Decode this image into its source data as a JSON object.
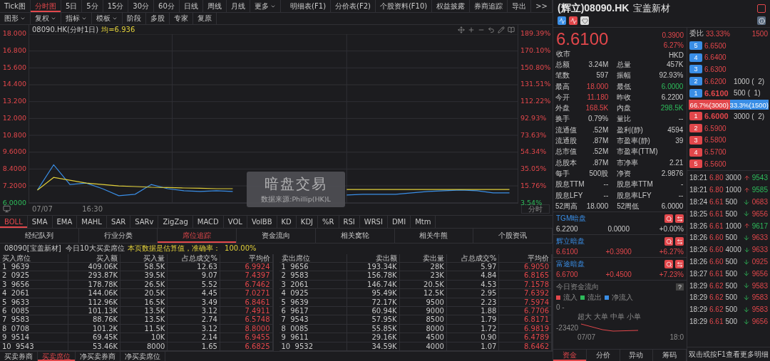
{
  "toolbar": {
    "tabs": [
      {
        "label": "Tick图",
        "selected": false,
        "dropdown": false
      },
      {
        "label": "分时图",
        "selected": true,
        "dropdown": false
      },
      {
        "label": "5日",
        "selected": false,
        "dropdown": false
      },
      {
        "label": "5分",
        "selected": false,
        "dropdown": false
      },
      {
        "label": "15分",
        "selected": false,
        "dropdown": false
      },
      {
        "label": "30分",
        "selected": false,
        "dropdown": false
      },
      {
        "label": "60分",
        "selected": false,
        "dropdown": false
      },
      {
        "label": "日线",
        "selected": false,
        "dropdown": false
      },
      {
        "label": "周线",
        "selected": false,
        "dropdown": false
      },
      {
        "label": "月线",
        "selected": false,
        "dropdown": false
      },
      {
        "label": "更多",
        "selected": false,
        "dropdown": true
      }
    ],
    "actions": [
      "明细表(F1)",
      "分价表(F2)",
      "个股资料(F10)",
      "权益披露",
      "券商追踪",
      "导出",
      ">>"
    ]
  },
  "subtoolbar": [
    {
      "label": "图形",
      "dropdown": true
    },
    {
      "label": "复权",
      "dropdown": true
    },
    {
      "label": "指标",
      "dropdown": true
    },
    {
      "label": "模板",
      "dropdown": true
    },
    {
      "label": "阶段",
      "dropdown": false
    },
    {
      "label": "多股",
      "dropdown": false
    },
    {
      "label": "专家",
      "dropdown": false
    },
    {
      "label": "复原",
      "dropdown": false
    }
  ],
  "chart": {
    "title": "08090.HK(分时1日)",
    "average": "均=6.936",
    "pct_ticks": [
      "189.39%",
      "170.10%",
      "150.80%",
      "131.51%",
      "112.22%",
      "92.93%",
      "73.63%",
      "54.34%",
      "35.05%",
      "15.76%",
      "3.54%"
    ],
    "x_labels": [
      "07/07",
      "16:30"
    ],
    "mode_button": "分时",
    "overlay_title": "暗盘交易",
    "overlay_source": "数据来源:Phillip(HK)L",
    "chart_data": {
      "type": "line",
      "grid": true,
      "ylim": [
        6,
        18
      ],
      "yticks": [
        {
          "value": 18,
          "label": "18.000"
        },
        {
          "value": 16.8,
          "label": "16.800"
        },
        {
          "value": 15.6,
          "label": "15.600"
        },
        {
          "value": 14.4,
          "label": "14.400"
        },
        {
          "value": 13.2,
          "label": "13.200"
        },
        {
          "value": 12,
          "label": "12.000"
        },
        {
          "value": 10.8,
          "label": "10.800"
        },
        {
          "value": 9.6,
          "label": "9.6000"
        },
        {
          "value": 8.4,
          "label": "8.4000"
        },
        {
          "value": 7.2,
          "label": "7.2000"
        },
        {
          "value": 6,
          "label": "6.0000"
        }
      ],
      "series": [
        {
          "color": "#3a8ee6",
          "values": [
            6.9,
            8.7,
            7.3,
            7.4,
            7.0,
            6.5,
            6.6,
            7.3,
            7.0,
            6.85,
            6.8,
            6.85,
            6.8,
            null,
            null,
            null,
            null,
            null,
            null,
            6.55,
            6.6,
            6.6,
            6.6,
            6.7,
            6.8,
            6.85,
            6.9,
            6.85,
            6.7,
            6.7
          ]
        },
        {
          "color": "#e0cf3a",
          "values": [
            6.9,
            7.8,
            7.6,
            7.4,
            7.3,
            7.2,
            7.15,
            7.1,
            7.08,
            7.05,
            7.03,
            7.0,
            7.0,
            null,
            null,
            null,
            null,
            null,
            null,
            6.94,
            6.94,
            6.94,
            6.94,
            6.94,
            6.94,
            6.94,
            6.94,
            6.94,
            6.94,
            6.94
          ]
        }
      ]
    }
  },
  "indicators": [
    {
      "label": "BOLL",
      "selected": true
    },
    {
      "label": "SMA",
      "selected": false
    },
    {
      "label": "EMA",
      "selected": false
    },
    {
      "label": "MAHL",
      "selected": false
    },
    {
      "label": "SAR",
      "selected": false
    },
    {
      "label": "SARv",
      "selected": false
    },
    {
      "label": "ZigZag",
      "selected": false
    },
    {
      "label": "MACD",
      "selected": false
    },
    {
      "label": "VOL",
      "selected": false
    },
    {
      "label": "VolBB",
      "selected": false
    },
    {
      "label": "KD",
      "selected": false
    },
    {
      "label": "KDJ",
      "selected": false
    },
    {
      "label": "%R",
      "selected": false
    },
    {
      "label": "RSI",
      "selected": false
    },
    {
      "label": "WRSI",
      "selected": false
    },
    {
      "label": "DMI",
      "selected": false
    },
    {
      "label": "Mtm",
      "selected": false
    }
  ],
  "sections": [
    {
      "label": "经纪队列",
      "selected": false
    },
    {
      "label": "行业分类",
      "selected": false
    },
    {
      "label": "席位追踪",
      "selected": true
    },
    {
      "label": "资金流向",
      "selected": false
    },
    {
      "label": "相关窝轮",
      "selected": false
    },
    {
      "label": "相关牛熊",
      "selected": false
    },
    {
      "label": "个股资讯",
      "selected": false
    }
  ],
  "info": {
    "prefix": "08090[宝盖新材]  今日10大买卖席位",
    "note": "本页数据是估算值，准确率：  100.00%"
  },
  "buy_table": {
    "columns": [
      "买入席位",
      "买入额",
      "买入量",
      "占总成交%",
      "平均价"
    ],
    "rows": [
      [
        "1  9639",
        "409.06K",
        "58.5K",
        "12.63",
        "6.9924"
      ],
      [
        "2  0925",
        "293.87K",
        "39.5K",
        "9.07",
        "7.4397"
      ],
      [
        "3  9656",
        "178.78K",
        "26.5K",
        "5.52",
        "6.7462"
      ],
      [
        "4  2061",
        "144.06K",
        "20.5K",
        "4.45",
        "7.0271"
      ],
      [
        "5  9633",
        "112.96K",
        "16.5K",
        "3.49",
        "6.8461"
      ],
      [
        "6  0085",
        "101.13K",
        "13.5K",
        "3.12",
        "7.4911"
      ],
      [
        "7  9583",
        "88.76K",
        "13.5K",
        "2.74",
        "6.5748"
      ],
      [
        "8  0708",
        "101.2K",
        "11.5K",
        "3.12",
        "8.8000"
      ],
      [
        "9  9514",
        "69.45K",
        "10K",
        "2.14",
        "6.9455"
      ],
      [
        "10  9543",
        "53.46K",
        "8000",
        "1.65",
        "6.6825"
      ]
    ]
  },
  "sell_table": {
    "columns": [
      "卖出席位",
      "卖出额",
      "卖出量",
      "占总成交%",
      "平均价"
    ],
    "rows": [
      [
        "1  9656",
        "193.34K",
        "28K",
        "5.97",
        "6.9050"
      ],
      [
        "2  9583",
        "156.78K",
        "23K",
        "4.84",
        "6.8165"
      ],
      [
        "3  2061",
        "146.74K",
        "20.5K",
        "4.53",
        "7.1578"
      ],
      [
        "4  0925",
        "95.49K",
        "12.5K",
        "2.95",
        "7.6392"
      ],
      [
        "5  9639",
        "72.17K",
        "9500",
        "2.23",
        "7.5974"
      ],
      [
        "6  9617",
        "60.94K",
        "9000",
        "1.88",
        "6.7706"
      ],
      [
        "7  9543",
        "57.95K",
        "8500",
        "1.79",
        "6.8171"
      ],
      [
        "8  0085",
        "55.85K",
        "8000",
        "1.72",
        "6.9819"
      ],
      [
        "9  9611",
        "29.16K",
        "4500",
        "0.90",
        "6.4789"
      ],
      [
        "10  9532",
        "34.59K",
        "4000",
        "1.07",
        "8.6462"
      ]
    ]
  },
  "bottom_tabs": [
    {
      "label": "买卖券商",
      "selected": false
    },
    {
      "label": "买卖席位",
      "selected": true
    },
    {
      "label": "净买卖券商",
      "selected": false
    },
    {
      "label": "净买卖席位",
      "selected": false
    }
  ],
  "quote": {
    "code": "(辉立)08090.HK",
    "name": "宝盖新材",
    "price": "6.6100",
    "change": "0.3900",
    "change_pct": "6.27%",
    "status": "收市",
    "currency": "HKD",
    "stats": [
      {
        "label": "总额",
        "value": "3.24M",
        "kind": "flat"
      },
      {
        "label": "总量",
        "value": "457K",
        "kind": "flat"
      },
      {
        "label": "笔数",
        "value": "597",
        "kind": "flat"
      },
      {
        "label": "振幅",
        "value": "92.93%",
        "kind": "flat"
      },
      {
        "label": "最高",
        "value": "18.000",
        "kind": "up"
      },
      {
        "label": "最低",
        "value": "6.0000",
        "kind": "down"
      },
      {
        "label": "今开",
        "value": "11.180",
        "kind": "up"
      },
      {
        "label": "昨收",
        "value": "6.2200",
        "kind": "flat"
      },
      {
        "label": "外盘",
        "value": "168.5K",
        "kind": "up"
      },
      {
        "label": "内盘",
        "value": "298.5K",
        "kind": "down"
      },
      {
        "label": "换手",
        "value": "0.79%",
        "kind": "flat"
      },
      {
        "label": "量比",
        "value": "--",
        "kind": "flat"
      },
      {
        "label": "流通值",
        "value": ".52M",
        "kind": "flat"
      },
      {
        "label": "盈利(静)",
        "value": "4594",
        "kind": "flat"
      },
      {
        "label": "流通股",
        "value": ".87M",
        "kind": "flat"
      },
      {
        "label": "市盈率(静)",
        "value": "39",
        "kind": "flat"
      },
      {
        "label": "总市值",
        "value": ".52M",
        "kind": "flat"
      },
      {
        "label": "市盈率(TTM)"
      },
      {
        "label": "总股本",
        "value": ".87M",
        "kind": "flat"
      },
      {
        "label": "市净率",
        "value": "2.21",
        "kind": "flat"
      },
      {
        "label": "每手",
        "value": "500股",
        "kind": "flat"
      },
      {
        "label": "净资",
        "value": "2.9876",
        "kind": "flat"
      },
      {
        "label": "股息TTM",
        "value": "--",
        "kind": "flat"
      },
      {
        "label": "股息率TTM",
        "value": "-",
        "kind": "flat"
      },
      {
        "label": "股息LFY",
        "value": "--",
        "kind": "flat"
      },
      {
        "label": "股息率LFY",
        "value": "--",
        "kind": "flat"
      },
      {
        "label": "52周高",
        "value": "18.000",
        "kind": "flat"
      },
      {
        "label": "52周低",
        "value": "6.0000",
        "kind": "flat"
      }
    ]
  },
  "dark_pools": [
    {
      "name": "TGM暗盘",
      "price": "6.2200",
      "change": "0.0000",
      "change_pct": "+0.00%",
      "kind": "flat"
    },
    {
      "name": "辉立暗盘",
      "price": "6.6100",
      "change": "+0.3900",
      "change_pct": "+6.27%",
      "kind": "up"
    },
    {
      "name": "富途暗盘",
      "price": "6.6700",
      "change": "+0.4500",
      "change_pct": "+7.23%",
      "kind": "up"
    }
  ],
  "fund_flow": {
    "title": "今日资金流向",
    "help": "?",
    "legend": [
      {
        "label": "流入",
        "color": "#e2474b"
      },
      {
        "label": "流出",
        "color": "#2dbb5a"
      },
      {
        "label": "净流入",
        "color": "#3a8ee6"
      }
    ],
    "zero": "0 -",
    "sizes": [
      "超大",
      "大单",
      "中单",
      "小单"
    ],
    "value": "-23420",
    "x_labels": [
      "07/07",
      "18:0"
    ]
  },
  "side_tabs": [
    {
      "label": "资金",
      "selected": true
    },
    {
      "label": "分价",
      "selected": false
    },
    {
      "label": "异动",
      "selected": false
    },
    {
      "label": "筹码",
      "selected": false
    }
  ],
  "order_book": {
    "ratio_label": "委比",
    "ratio_pct": "33.33%",
    "ratio_diff": "1500",
    "asks": [
      {
        "level": "5",
        "price": "6.6500"
      },
      {
        "level": "4",
        "price": "6.6400"
      },
      {
        "level": "3",
        "price": "6.6300"
      },
      {
        "level": "2",
        "price": "6.6200",
        "volume": "1000",
        "orders": "(  2)"
      },
      {
        "level": "1",
        "price": "6.6100",
        "volume": "500",
        "orders": "(  1)"
      }
    ],
    "split": {
      "bid": "66.7%(3000)",
      "ask": "33.3%(1500)"
    },
    "bids": [
      {
        "level": "1",
        "price": "6.6000",
        "volume": "3000",
        "orders": "(  2)"
      },
      {
        "level": "2",
        "price": "6.5900"
      },
      {
        "level": "3",
        "price": "6.5800"
      },
      {
        "level": "4",
        "price": "6.5700"
      },
      {
        "level": "5",
        "price": "6.5600"
      }
    ]
  },
  "trades": [
    {
      "time": "18:21",
      "price": "6.80",
      "volume": "3000",
      "kind": "up",
      "broker": "9543"
    },
    {
      "time": "18:21",
      "price": "6.80",
      "volume": "1000",
      "kind": "up",
      "broker": "9585"
    },
    {
      "time": "18:24",
      "price": "6.61",
      "volume": "500",
      "kind": "down",
      "broker": "0683"
    },
    {
      "time": "18:25",
      "price": "6.61",
      "volume": "500",
      "kind": "down",
      "broker": "9656"
    },
    {
      "time": "18:26",
      "price": "6.61",
      "volume": "1000",
      "kind": "up",
      "broker": "9617"
    },
    {
      "time": "18:26",
      "price": "6.60",
      "volume": "500",
      "kind": "down",
      "broker": "9633"
    },
    {
      "time": "18:26",
      "price": "6.60",
      "volume": "4000",
      "kind": "down",
      "broker": "9633"
    },
    {
      "time": "18:26",
      "price": "6.60",
      "volume": "500",
      "kind": "down",
      "broker": "0925"
    },
    {
      "time": "18:27",
      "price": "6.61",
      "volume": "500",
      "kind": "down",
      "broker": "9656"
    },
    {
      "time": "18:29",
      "price": "6.62",
      "volume": "500",
      "kind": "down",
      "broker": "9583"
    },
    {
      "time": "18:29",
      "price": "6.62",
      "volume": "500",
      "kind": "down",
      "broker": "9583"
    },
    {
      "time": "18:29",
      "price": "6.62",
      "volume": "500",
      "kind": "down",
      "broker": "9583"
    },
    {
      "time": "18:29",
      "price": "6.61",
      "volume": "500",
      "kind": "down",
      "broker": "9656"
    }
  ],
  "trades_footer": "双击或按F1查看更多明细"
}
